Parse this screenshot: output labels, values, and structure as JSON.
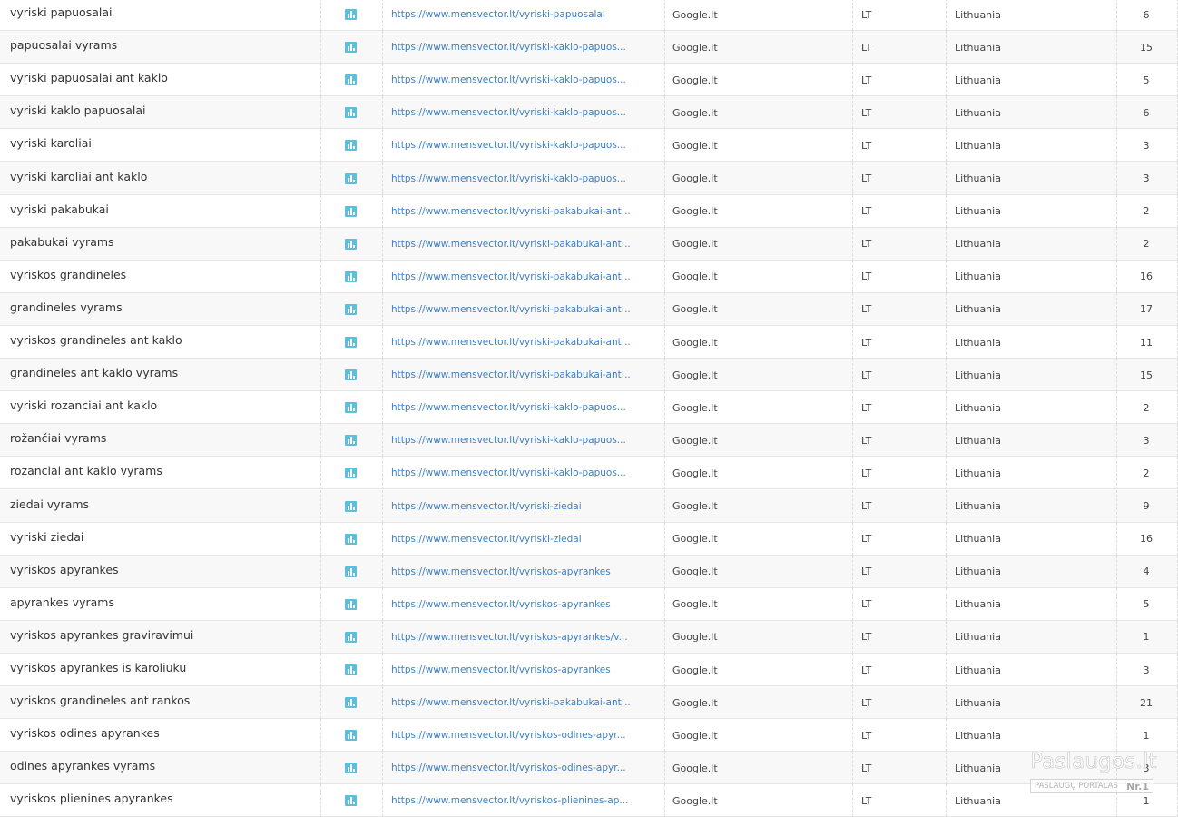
{
  "icons": {
    "row_icon": "chart-bar-icon",
    "accent": "#5bc0de",
    "link_color": "#3b7fc4"
  },
  "rows": [
    {
      "keyword": "vyriski papuosalai",
      "url": "https://www.mensvector.lt/vyriski-papuosalai",
      "engine": "Google.lt",
      "country_code": "LT",
      "country": "Lithuania",
      "position": "6"
    },
    {
      "keyword": "papuosalai vyrams",
      "url": "https://www.mensvector.lt/vyriski-kaklo-papuos...",
      "engine": "Google.lt",
      "country_code": "LT",
      "country": "Lithuania",
      "position": "15"
    },
    {
      "keyword": "vyriski papuosalai ant kaklo",
      "url": "https://www.mensvector.lt/vyriski-kaklo-papuos...",
      "engine": "Google.lt",
      "country_code": "LT",
      "country": "Lithuania",
      "position": "5"
    },
    {
      "keyword": "vyriski kaklo papuosalai",
      "url": "https://www.mensvector.lt/vyriski-kaklo-papuos...",
      "engine": "Google.lt",
      "country_code": "LT",
      "country": "Lithuania",
      "position": "6"
    },
    {
      "keyword": "vyriski karoliai",
      "url": "https://www.mensvector.lt/vyriski-kaklo-papuos...",
      "engine": "Google.lt",
      "country_code": "LT",
      "country": "Lithuania",
      "position": "3"
    },
    {
      "keyword": "vyriski karoliai ant kaklo",
      "url": "https://www.mensvector.lt/vyriski-kaklo-papuos...",
      "engine": "Google.lt",
      "country_code": "LT",
      "country": "Lithuania",
      "position": "3"
    },
    {
      "keyword": "vyriski pakabukai",
      "url": "https://www.mensvector.lt/vyriski-pakabukai-ant...",
      "engine": "Google.lt",
      "country_code": "LT",
      "country": "Lithuania",
      "position": "2"
    },
    {
      "keyword": "pakabukai vyrams",
      "url": "https://www.mensvector.lt/vyriski-pakabukai-ant...",
      "engine": "Google.lt",
      "country_code": "LT",
      "country": "Lithuania",
      "position": "2"
    },
    {
      "keyword": "vyriskos grandineles",
      "url": "https://www.mensvector.lt/vyriski-pakabukai-ant...",
      "engine": "Google.lt",
      "country_code": "LT",
      "country": "Lithuania",
      "position": "16"
    },
    {
      "keyword": "grandineles vyrams",
      "url": "https://www.mensvector.lt/vyriski-pakabukai-ant...",
      "engine": "Google.lt",
      "country_code": "LT",
      "country": "Lithuania",
      "position": "17"
    },
    {
      "keyword": "vyriskos grandineles ant kaklo",
      "url": "https://www.mensvector.lt/vyriski-pakabukai-ant...",
      "engine": "Google.lt",
      "country_code": "LT",
      "country": "Lithuania",
      "position": "11"
    },
    {
      "keyword": "grandineles ant kaklo vyrams",
      "url": "https://www.mensvector.lt/vyriski-pakabukai-ant...",
      "engine": "Google.lt",
      "country_code": "LT",
      "country": "Lithuania",
      "position": "15"
    },
    {
      "keyword": "vyriski rozanciai ant kaklo",
      "url": "https://www.mensvector.lt/vyriski-kaklo-papuos...",
      "engine": "Google.lt",
      "country_code": "LT",
      "country": "Lithuania",
      "position": "2"
    },
    {
      "keyword": "rožančiai vyrams",
      "url": "https://www.mensvector.lt/vyriski-kaklo-papuos...",
      "engine": "Google.lt",
      "country_code": "LT",
      "country": "Lithuania",
      "position": "3"
    },
    {
      "keyword": "rozanciai ant kaklo vyrams",
      "url": "https://www.mensvector.lt/vyriski-kaklo-papuos...",
      "engine": "Google.lt",
      "country_code": "LT",
      "country": "Lithuania",
      "position": "2"
    },
    {
      "keyword": "ziedai vyrams",
      "url": "https://www.mensvector.lt/vyriski-ziedai",
      "engine": "Google.lt",
      "country_code": "LT",
      "country": "Lithuania",
      "position": "9"
    },
    {
      "keyword": "vyriski ziedai",
      "url": "https://www.mensvector.lt/vyriski-ziedai",
      "engine": "Google.lt",
      "country_code": "LT",
      "country": "Lithuania",
      "position": "16"
    },
    {
      "keyword": "vyriskos apyrankes",
      "url": "https://www.mensvector.lt/vyriskos-apyrankes",
      "engine": "Google.lt",
      "country_code": "LT",
      "country": "Lithuania",
      "position": "4"
    },
    {
      "keyword": "apyrankes vyrams",
      "url": "https://www.mensvector.lt/vyriskos-apyrankes",
      "engine": "Google.lt",
      "country_code": "LT",
      "country": "Lithuania",
      "position": "5"
    },
    {
      "keyword": "vyriskos apyrankes graviravimui",
      "url": "https://www.mensvector.lt/vyriskos-apyrankes/v...",
      "engine": "Google.lt",
      "country_code": "LT",
      "country": "Lithuania",
      "position": "1"
    },
    {
      "keyword": "vyriskos apyrankes is karoliuku",
      "url": "https://www.mensvector.lt/vyriskos-apyrankes",
      "engine": "Google.lt",
      "country_code": "LT",
      "country": "Lithuania",
      "position": "3"
    },
    {
      "keyword": "vyriskos grandineles ant rankos",
      "url": "https://www.mensvector.lt/vyriski-pakabukai-ant...",
      "engine": "Google.lt",
      "country_code": "LT",
      "country": "Lithuania",
      "position": "21"
    },
    {
      "keyword": "vyriskos odines apyrankes",
      "url": "https://www.mensvector.lt/vyriskos-odines-apyr...",
      "engine": "Google.lt",
      "country_code": "LT",
      "country": "Lithuania",
      "position": "1"
    },
    {
      "keyword": "odines apyrankes vyrams",
      "url": "https://www.mensvector.lt/vyriskos-odines-apyr...",
      "engine": "Google.lt",
      "country_code": "LT",
      "country": "Lithuania",
      "position": "3"
    },
    {
      "keyword": "vyriskos plienines apyrankes",
      "url": "https://www.mensvector.lt/vyriskos-plienines-ap...",
      "engine": "Google.lt",
      "country_code": "LT",
      "country": "Lithuania",
      "position": "1"
    }
  ],
  "watermark": {
    "brand": "Paslaugos.lt",
    "tagline": "PASLAUGŲ PORTALAS",
    "rank": "Nr.1"
  }
}
